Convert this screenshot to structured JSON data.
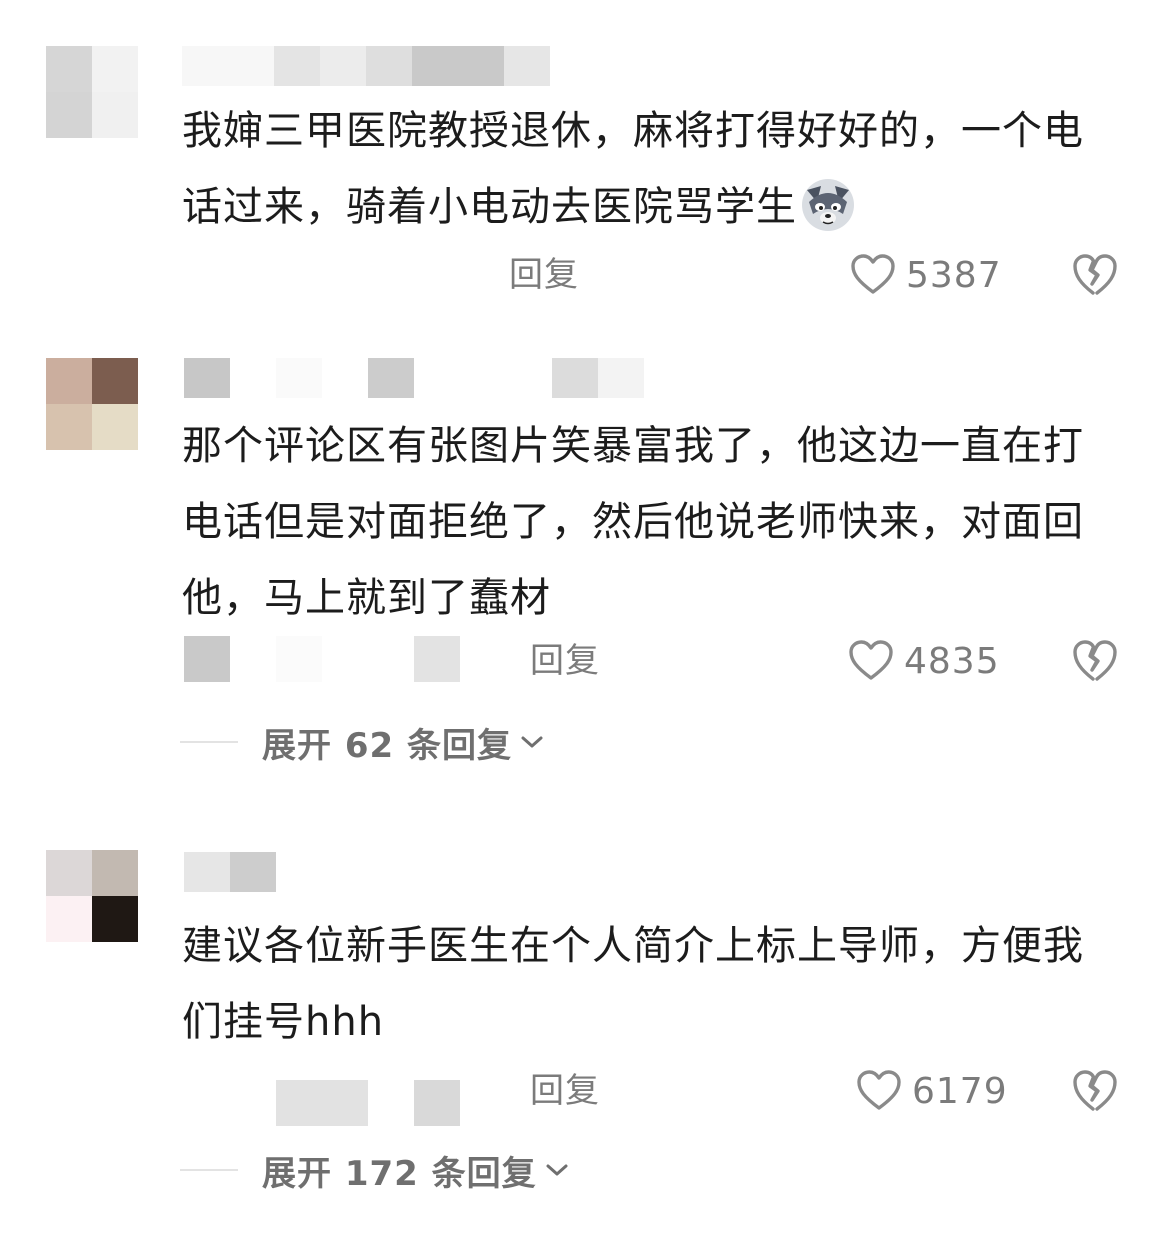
{
  "comments": [
    {
      "text": "我婶三甲医院教授退休，麻将打得好好的，一个电话过来，骑着小电动去医院骂学生",
      "emoji": "wolf-face-emoji",
      "reply_label": "回复",
      "likes": "5387",
      "avatar_colors": [
        "#d6d6d6",
        "#f2f2f2",
        "#d4d4d4",
        "#f0f0f0"
      ]
    },
    {
      "text": "那个评论区有张图片笑暴富我了，他这边一直在打电话但是对面拒绝了，然后他说老师快来，对面回他，马上就到了蠢材",
      "reply_label": "回复",
      "likes": "4835",
      "expand_label": "展开 62 条回复",
      "avatar_colors": [
        "#cbae9e",
        "#7c5d4f",
        "#d7c2ae",
        "#e5dcc6"
      ]
    },
    {
      "text": "建议各位新手医生在个人简介上标上导师，方便我们挂号hhh",
      "reply_label": "回复",
      "likes": "6179",
      "expand_label": "展开 172 条回复",
      "avatar_colors": [
        "#dcd7d7",
        "#c2b9b1",
        "#fcf1f3",
        "#1f1814"
      ]
    }
  ],
  "colors": {
    "text": "#1c1c1c",
    "meta": "#7b7b7b",
    "background": "#ffffff"
  }
}
